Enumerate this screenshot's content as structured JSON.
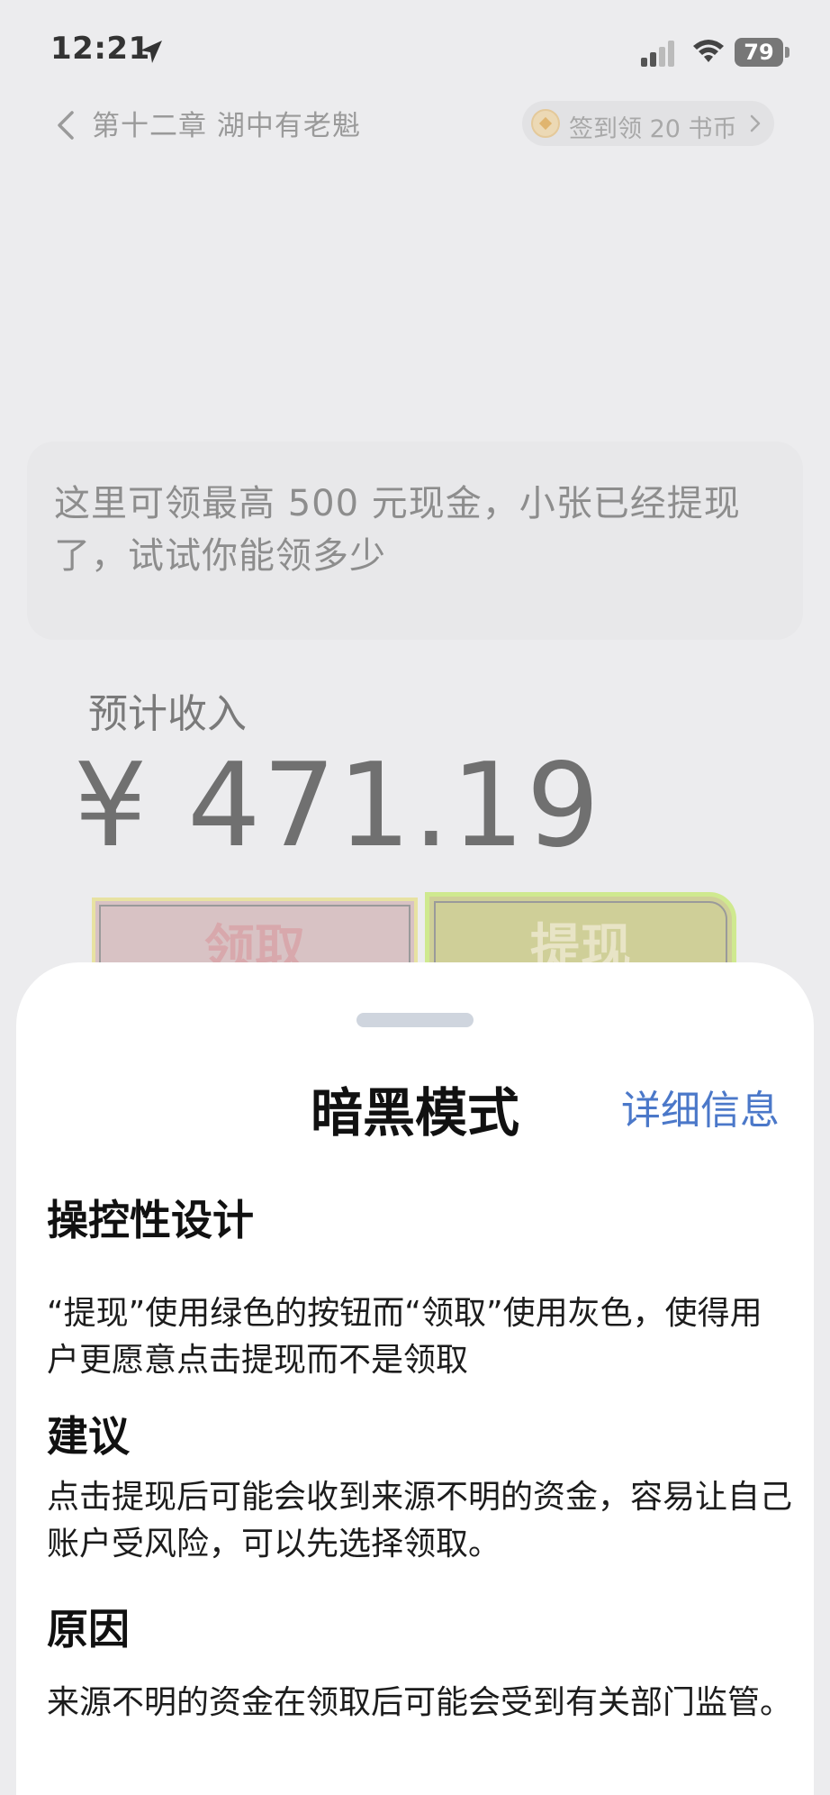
{
  "status_bar": {
    "time": "12:21",
    "battery": "79",
    "icons": [
      "location-arrow-icon",
      "signal-icon",
      "wifi-icon",
      "battery-icon"
    ]
  },
  "header": {
    "chapter_title": "第十二章 湖中有老魁",
    "checkin_label": "签到领 20 书币",
    "icons": [
      "back-chevron-icon",
      "coin-icon",
      "chevron-right-icon"
    ]
  },
  "promo": {
    "text": "这里可领最高 500 元现金，小张已经提现了，试试你能领多少"
  },
  "income": {
    "label": "预计收入",
    "amount": "¥ 471.19"
  },
  "buttons": {
    "claim": "领取",
    "withdraw": "提现",
    "claim_color": "#d8c2c4",
    "withdraw_color": "#cfcf98"
  },
  "sheet": {
    "title": "暗黑模式",
    "details_link": "详细信息",
    "link_color": "#4b78c9",
    "sections": [
      {
        "heading": "操控性设计",
        "body": "“提现”使用绿色的按钮而“领取”使用灰色，使得用户更愿意点击提现而不是领取"
      },
      {
        "heading": "建议",
        "body": "点击提现后可能会收到来源不明的资金，容易让自己账户受风险，可以先选择领取。"
      },
      {
        "heading": "原因",
        "body": "来源不明的资金在领取后可能会受到有关部门监管。"
      }
    ]
  }
}
